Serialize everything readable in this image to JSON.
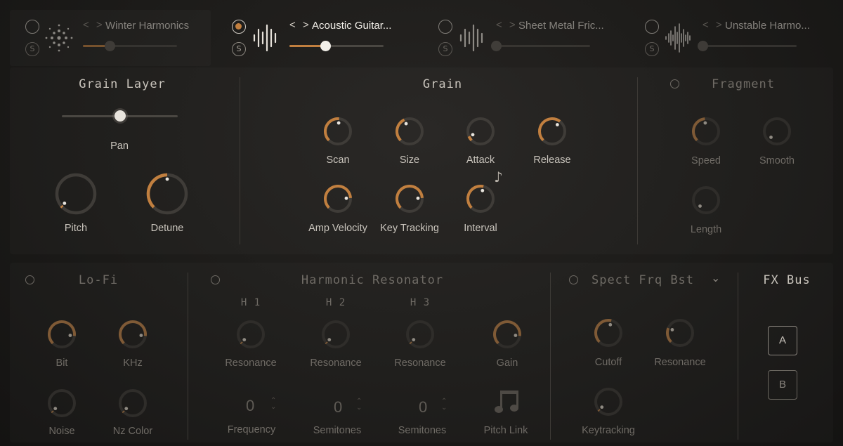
{
  "slots": [
    {
      "name": "Winter Harmonics",
      "power_on": false,
      "solo": "S",
      "level": 0.28,
      "icon": "snowflake-dots-icon"
    },
    {
      "name": "Acoustic Guitar...",
      "power_on": true,
      "solo": "S",
      "level": 0.38,
      "icon": "waveform-icon"
    },
    {
      "name": "Sheet Metal Fric...",
      "power_on": false,
      "solo": "S",
      "level": 0.0,
      "icon": "waveform-icon"
    },
    {
      "name": "Unstable Harmo...",
      "power_on": false,
      "solo": "S",
      "level": 0.0,
      "icon": "noisy-waveform-icon"
    }
  ],
  "nav_arrows": "< >",
  "grain_layer": {
    "title": "Grain Layer",
    "pan_label": "Pan",
    "pan_value": 0.5,
    "knobs": [
      {
        "label": "Pitch",
        "value": 0.02
      },
      {
        "label": "Detune",
        "value": 0.5
      }
    ]
  },
  "grain": {
    "title": "Grain",
    "knobs": [
      {
        "label": "Scan",
        "value": 0.52
      },
      {
        "label": "Size",
        "value": 0.41
      },
      {
        "label": "Attack",
        "value": 0.08
      },
      {
        "label": "Release",
        "value": 0.64
      },
      {
        "label": "Amp Velocity",
        "value": 0.82
      },
      {
        "label": "Key Tracking",
        "value": 0.82
      },
      {
        "label": "Interval",
        "value": 0.55
      }
    ],
    "note_icon": "music-note-icon"
  },
  "fragment": {
    "title": "Fragment",
    "knobs": [
      {
        "label": "Speed",
        "value": 0.48
      },
      {
        "label": "Smooth",
        "value": 0.0
      },
      {
        "label": "Length",
        "value": 0.0
      }
    ]
  },
  "lofi": {
    "title": "Lo-Fi",
    "knobs": [
      {
        "label": "Bit",
        "value": 0.86
      },
      {
        "label": "KHz",
        "value": 0.86
      },
      {
        "label": "Noise",
        "value": 0.02
      },
      {
        "label": "Nz Color",
        "value": 0.02
      }
    ]
  },
  "harmonic_resonator": {
    "title": "Harmonic Resonator",
    "headers": [
      "H 1",
      "H 2",
      "H 3"
    ],
    "knobs": [
      {
        "label": "Resonance",
        "value": 0.02
      },
      {
        "label": "Resonance",
        "value": 0.02
      },
      {
        "label": "Resonance",
        "value": 0.02
      },
      {
        "label": "Gain",
        "value": 0.86
      }
    ],
    "values": [
      {
        "value": "0",
        "label": "Frequency"
      },
      {
        "value": "0",
        "label": "Semitones"
      },
      {
        "value": "0",
        "label": "Semitones"
      }
    ],
    "pitch_link_label": "Pitch Link"
  },
  "spect": {
    "title": "Spect Frq Bst",
    "knobs": [
      {
        "label": "Cutoff",
        "value": 0.55
      },
      {
        "label": "Resonance",
        "value": 0.25
      },
      {
        "label": "Keytracking",
        "value": 0.02
      }
    ]
  },
  "fx_bus": {
    "title": "FX Bus",
    "buttons": [
      "A",
      "B"
    ]
  },
  "colors": {
    "accent": "#c17f3f",
    "track": "#3f3c38",
    "text": "#c9c4bc",
    "dim": "#6f6b65"
  }
}
